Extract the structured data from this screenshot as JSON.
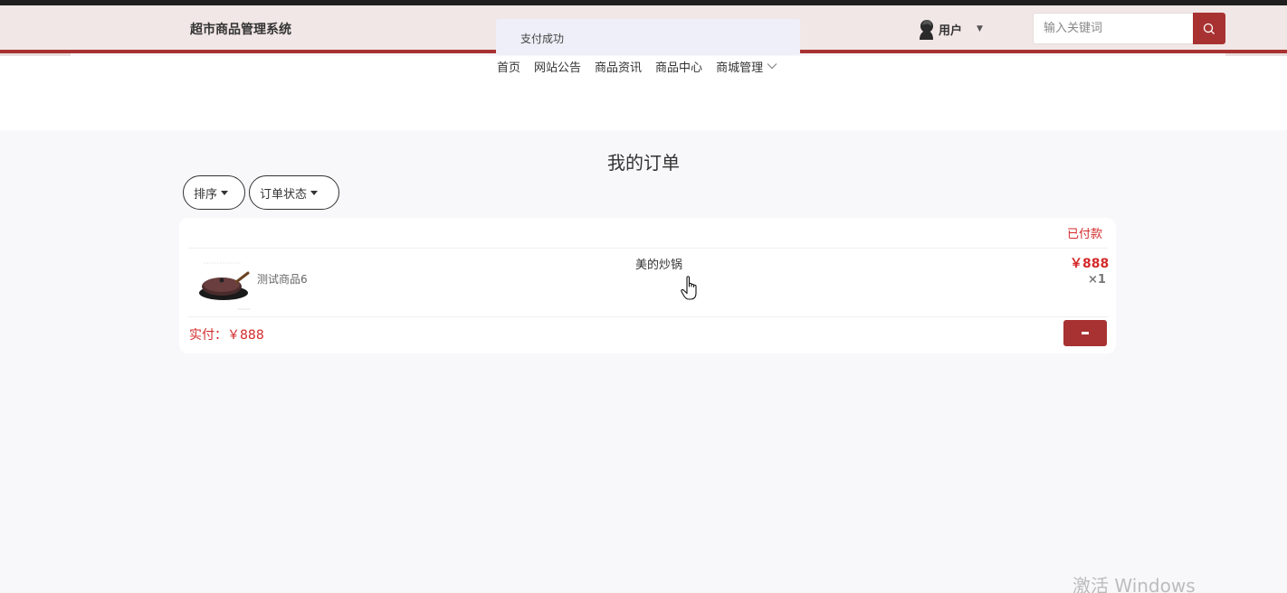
{
  "app": {
    "brand": "超市商品管理系统"
  },
  "notification": {
    "message": "支付成功"
  },
  "user": {
    "name": "用户"
  },
  "search": {
    "placeholder": "输入关键词"
  },
  "nav": {
    "items": [
      {
        "label": "首页"
      },
      {
        "label": "网站公告"
      },
      {
        "label": "商品资讯"
      },
      {
        "label": "商品中心"
      },
      {
        "label": "商城管理"
      }
    ]
  },
  "page": {
    "title": "我的订单"
  },
  "filters": {
    "sort_label": "排序",
    "status_label": "订单状态"
  },
  "order": {
    "status": "已付款",
    "item_code": "测试商品6",
    "item_name": "美的炒锅",
    "price": "￥888",
    "quantity": "×1",
    "paid": "实付：￥888"
  },
  "system": {
    "watermark": "激活 Windows"
  },
  "colors": {
    "accent": "#a83232",
    "price": "#d42a2a",
    "header_bg": "#f1e7e6",
    "page_bg": "#f8f7fa"
  }
}
